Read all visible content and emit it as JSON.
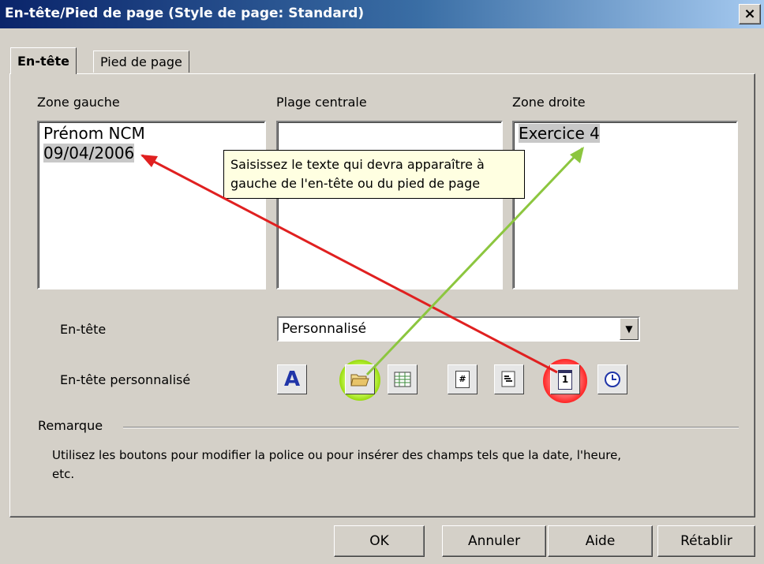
{
  "window": {
    "title": "En-tête/Pied de page (Style de page: Standard)",
    "close_label": "×"
  },
  "tabs": [
    {
      "label": "En-tête",
      "selected": true
    },
    {
      "label": "Pied de page",
      "selected": false
    }
  ],
  "zones": {
    "left": {
      "label": "Zone gauche",
      "line1": "Prénom NCM",
      "line2": "09/04/2006"
    },
    "center": {
      "label": "Plage centrale"
    },
    "right": {
      "label": "Zone droite",
      "line1": "Exercice 4"
    }
  },
  "tooltip": {
    "line1": "Saisissez le texte qui devra apparaître à",
    "line2": "gauche de l'en-tête ou du pied de page"
  },
  "header_select": {
    "label": "En-tête",
    "value": "Personnalisé"
  },
  "custom_header": {
    "label": "En-tête personnalisé",
    "buttons": [
      {
        "name": "font-attributes-icon",
        "glyph": "A"
      },
      {
        "name": "file-name-icon"
      },
      {
        "name": "sheet-name-icon"
      },
      {
        "name": "page-number-icon",
        "glyph": "#"
      },
      {
        "name": "page-count-icon"
      },
      {
        "name": "date-icon",
        "glyph": "1"
      },
      {
        "name": "time-icon"
      }
    ]
  },
  "remark": {
    "label": "Remarque",
    "line1": "Utilisez les boutons pour modifier la police ou pour insérer des champs tels que la date, l'heure,",
    "line2": "etc."
  },
  "buttons": {
    "ok": "OK",
    "cancel": "Annuler",
    "help": "Aide",
    "reset": "Rétablir"
  },
  "annotations": {
    "highlight_colors": {
      "file_name_button": "#8fd400",
      "date_button": "#ff2020"
    },
    "arrow_colors": {
      "red": "#e02020",
      "green": "#8cc63f"
    }
  }
}
